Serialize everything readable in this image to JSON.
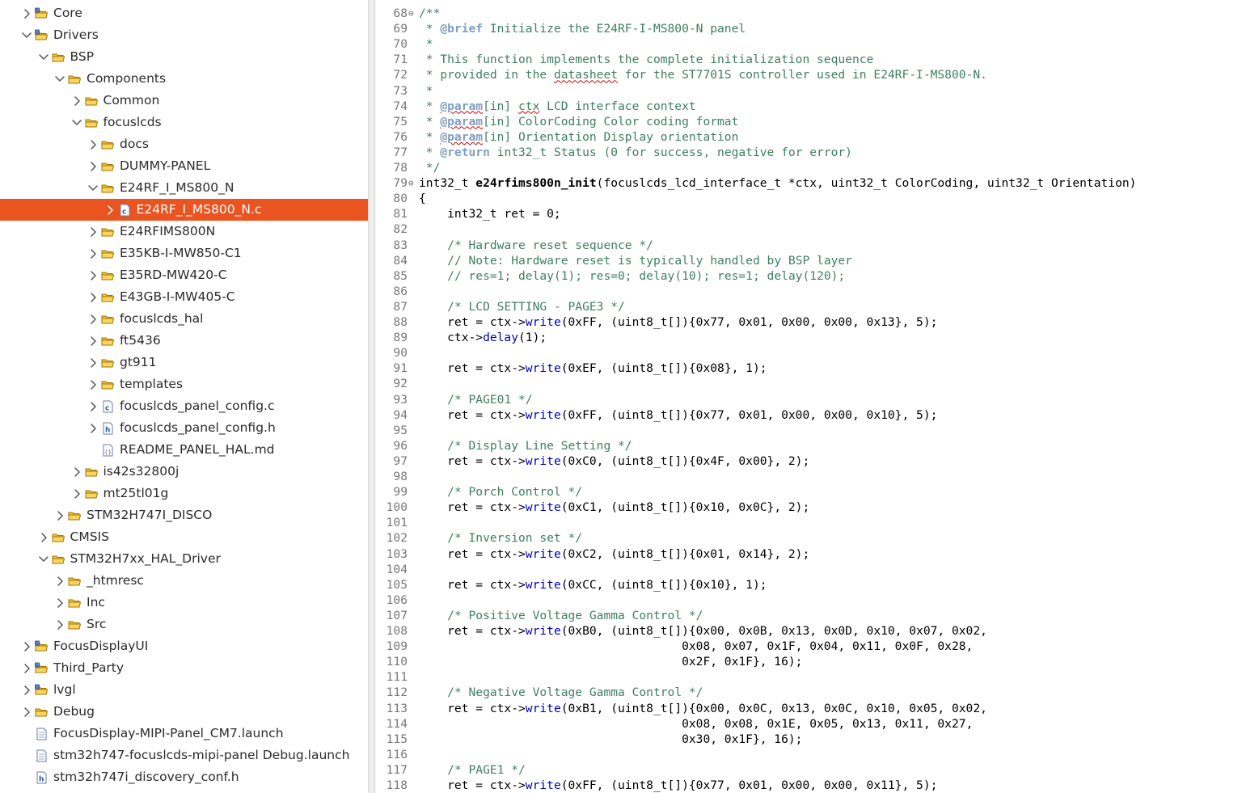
{
  "colors": {
    "selection_bg": "#e95420",
    "comment": "#3f7f5f",
    "method": "#0000c0",
    "line_number": "#787878",
    "folder": "#e0a000"
  },
  "tree": [
    {
      "label": "Core",
      "level": 1,
      "chevron": "right",
      "icon": "project-folder-icon"
    },
    {
      "label": "Drivers",
      "level": 1,
      "chevron": "down",
      "icon": "project-folder-icon"
    },
    {
      "label": "BSP",
      "level": 2,
      "chevron": "down",
      "icon": "folder-icon"
    },
    {
      "label": "Components",
      "level": 3,
      "chevron": "down",
      "icon": "folder-icon"
    },
    {
      "label": "Common",
      "level": 4,
      "chevron": "right",
      "icon": "folder-icon"
    },
    {
      "label": "focuslcds",
      "level": 4,
      "chevron": "down",
      "icon": "folder-icon"
    },
    {
      "label": "docs",
      "level": 5,
      "chevron": "right",
      "icon": "folder-icon"
    },
    {
      "label": "DUMMY-PANEL",
      "level": 5,
      "chevron": "right",
      "icon": "folder-icon"
    },
    {
      "label": "E24RF_I_MS800_N",
      "level": 5,
      "chevron": "down",
      "icon": "folder-icon"
    },
    {
      "label": "E24RF_I_MS800_N.c",
      "level": 6,
      "chevron": "right",
      "icon": "c-file-icon",
      "selected": true
    },
    {
      "label": "E24RFIMS800N",
      "level": 5,
      "chevron": "right",
      "icon": "folder-icon"
    },
    {
      "label": "E35KB-I-MW850-C1",
      "level": 5,
      "chevron": "right",
      "icon": "folder-icon"
    },
    {
      "label": "E35RD-MW420-C",
      "level": 5,
      "chevron": "right",
      "icon": "folder-icon"
    },
    {
      "label": "E43GB-I-MW405-C",
      "level": 5,
      "chevron": "right",
      "icon": "folder-icon"
    },
    {
      "label": "focuslcds_hal",
      "level": 5,
      "chevron": "right",
      "icon": "folder-icon"
    },
    {
      "label": "ft5436",
      "level": 5,
      "chevron": "right",
      "icon": "folder-icon"
    },
    {
      "label": "gt911",
      "level": 5,
      "chevron": "right",
      "icon": "folder-icon"
    },
    {
      "label": "templates",
      "level": 5,
      "chevron": "right",
      "icon": "folder-icon"
    },
    {
      "label": "focuslcds_panel_config.c",
      "level": 5,
      "chevron": "right",
      "icon": "c-file-icon"
    },
    {
      "label": "focuslcds_panel_config.h",
      "level": 5,
      "chevron": "right",
      "icon": "h-file-icon"
    },
    {
      "label": "README_PANEL_HAL.md",
      "level": 5,
      "chevron": "none",
      "icon": "md-file-icon"
    },
    {
      "label": "is42s32800j",
      "level": 4,
      "chevron": "right",
      "icon": "folder-icon"
    },
    {
      "label": "mt25tl01g",
      "level": 4,
      "chevron": "right",
      "icon": "folder-icon"
    },
    {
      "label": "STM32H747I_DISCO",
      "level": 3,
      "chevron": "right",
      "icon": "folder-icon"
    },
    {
      "label": "CMSIS",
      "level": 2,
      "chevron": "right",
      "icon": "folder-icon"
    },
    {
      "label": "STM32H7xx_HAL_Driver",
      "level": 2,
      "chevron": "down",
      "icon": "folder-icon"
    },
    {
      "label": "_htmresc",
      "level": 3,
      "chevron": "right",
      "icon": "folder-icon"
    },
    {
      "label": "Inc",
      "level": 3,
      "chevron": "right",
      "icon": "folder-icon"
    },
    {
      "label": "Src",
      "level": 3,
      "chevron": "right",
      "icon": "folder-icon"
    },
    {
      "label": "FocusDisplayUI",
      "level": 1,
      "chevron": "right",
      "icon": "project-folder-icon"
    },
    {
      "label": "Third_Party",
      "level": 1,
      "chevron": "right",
      "icon": "project-folder-icon"
    },
    {
      "label": "lvgl",
      "level": 1,
      "chevron": "right",
      "icon": "project-folder-icon"
    },
    {
      "label": "Debug",
      "level": 1,
      "chevron": "right",
      "icon": "folder-icon"
    },
    {
      "label": "FocusDisplay-MIPI-Panel_CM7.launch",
      "level": 1,
      "chevron": "none",
      "icon": "file-icon"
    },
    {
      "label": "stm32h747-focuslcds-mipi-panel Debug.launch",
      "level": 1,
      "chevron": "none",
      "icon": "file-icon"
    },
    {
      "label": "stm32h747i_discovery_conf.h",
      "level": 1,
      "chevron": "none",
      "icon": "h-file-icon"
    }
  ],
  "code": [
    {
      "n": "68",
      "fold": true,
      "segs": [
        {
          "t": "/**",
          "c": "comment"
        }
      ]
    },
    {
      "n": "69",
      "segs": [
        {
          "t": " * ",
          "c": "comment"
        },
        {
          "t": "@brief",
          "c": "doctag"
        },
        {
          "t": " Initialize the E24RF-I-MS800-N panel",
          "c": "comment"
        }
      ]
    },
    {
      "n": "70",
      "segs": [
        {
          "t": " *",
          "c": "comment"
        }
      ]
    },
    {
      "n": "71",
      "segs": [
        {
          "t": " * This function implements the complete initialization sequence",
          "c": "comment"
        }
      ]
    },
    {
      "n": "72",
      "segs": [
        {
          "t": " * provided in the ",
          "c": "comment"
        },
        {
          "t": "datasheet",
          "c": "comment",
          "sq": true
        },
        {
          "t": " for the ST7701S controller used in E24RF-I-MS800-N.",
          "c": "comment"
        }
      ]
    },
    {
      "n": "73",
      "segs": [
        {
          "t": " *",
          "c": "comment"
        }
      ]
    },
    {
      "n": "74",
      "segs": [
        {
          "t": " * ",
          "c": "comment"
        },
        {
          "t": "@param",
          "c": "doctag",
          "sq": true
        },
        {
          "t": "[in] ",
          "c": "comment"
        },
        {
          "t": "ctx",
          "c": "comment",
          "sq": true
        },
        {
          "t": " LCD interface context",
          "c": "comment"
        }
      ]
    },
    {
      "n": "75",
      "segs": [
        {
          "t": " * ",
          "c": "comment"
        },
        {
          "t": "@param",
          "c": "doctag",
          "sq": true
        },
        {
          "t": "[in] ColorCoding Color coding format",
          "c": "comment"
        }
      ]
    },
    {
      "n": "76",
      "segs": [
        {
          "t": " * ",
          "c": "comment"
        },
        {
          "t": "@param",
          "c": "doctag",
          "sq": true
        },
        {
          "t": "[in] Orientation Display orientation",
          "c": "comment"
        }
      ]
    },
    {
      "n": "77",
      "segs": [
        {
          "t": " * ",
          "c": "comment"
        },
        {
          "t": "@return",
          "c": "doctag"
        },
        {
          "t": " int32_t Status (0 for success, negative for error)",
          "c": "comment"
        }
      ]
    },
    {
      "n": "78",
      "segs": [
        {
          "t": " */",
          "c": "comment"
        }
      ]
    },
    {
      "n": "79",
      "fold": true,
      "segs": [
        {
          "t": "int32_t "
        },
        {
          "t": "e24rfims800n_init",
          "c": "fn"
        },
        {
          "t": "(focuslcds_lcd_interface_t *ctx, uint32_t ColorCoding, uint32_t Orientation)"
        }
      ]
    },
    {
      "n": "80",
      "segs": [
        {
          "t": "{"
        }
      ]
    },
    {
      "n": "81",
      "segs": [
        {
          "t": "    int32_t ret = 0;"
        }
      ]
    },
    {
      "n": "82",
      "segs": []
    },
    {
      "n": "83",
      "segs": [
        {
          "t": "    "
        },
        {
          "t": "/* Hardware reset sequence */",
          "c": "comment"
        }
      ]
    },
    {
      "n": "84",
      "segs": [
        {
          "t": "    "
        },
        {
          "t": "// Note: Hardware reset is typically handled by BSP layer",
          "c": "comment"
        }
      ]
    },
    {
      "n": "85",
      "segs": [
        {
          "t": "    "
        },
        {
          "t": "// res=1; delay(1); res=0; delay(10); res=1; delay(120);",
          "c": "comment"
        }
      ]
    },
    {
      "n": "86",
      "segs": []
    },
    {
      "n": "87",
      "segs": [
        {
          "t": "    "
        },
        {
          "t": "/* LCD SETTING - PAGE3 */",
          "c": "comment"
        }
      ]
    },
    {
      "n": "88",
      "segs": [
        {
          "t": "    ret = ctx->"
        },
        {
          "t": "write",
          "c": "method"
        },
        {
          "t": "(0xFF, (uint8_t[]){0x77, 0x01, 0x00, 0x00, 0x13}, 5);"
        }
      ]
    },
    {
      "n": "89",
      "segs": [
        {
          "t": "    ctx->"
        },
        {
          "t": "delay",
          "c": "method"
        },
        {
          "t": "(1);"
        }
      ]
    },
    {
      "n": "90",
      "segs": []
    },
    {
      "n": "91",
      "segs": [
        {
          "t": "    ret = ctx->"
        },
        {
          "t": "write",
          "c": "method"
        },
        {
          "t": "(0xEF, (uint8_t[]){0x08}, 1);"
        }
      ]
    },
    {
      "n": "92",
      "segs": []
    },
    {
      "n": "93",
      "segs": [
        {
          "t": "    "
        },
        {
          "t": "/* PAGE01 */",
          "c": "comment"
        }
      ]
    },
    {
      "n": "94",
      "segs": [
        {
          "t": "    ret = ctx->"
        },
        {
          "t": "write",
          "c": "method"
        },
        {
          "t": "(0xFF, (uint8_t[]){0x77, 0x01, 0x00, 0x00, 0x10}, 5);"
        }
      ]
    },
    {
      "n": "95",
      "segs": []
    },
    {
      "n": "96",
      "segs": [
        {
          "t": "    "
        },
        {
          "t": "/* Display Line Setting */",
          "c": "comment"
        }
      ]
    },
    {
      "n": "97",
      "segs": [
        {
          "t": "    ret = ctx->"
        },
        {
          "t": "write",
          "c": "method"
        },
        {
          "t": "(0xC0, (uint8_t[]){0x4F, 0x00}, 2);"
        }
      ]
    },
    {
      "n": "98",
      "segs": []
    },
    {
      "n": "99",
      "segs": [
        {
          "t": "    "
        },
        {
          "t": "/* Porch Control */",
          "c": "comment"
        }
      ]
    },
    {
      "n": "100",
      "segs": [
        {
          "t": "    ret = ctx->"
        },
        {
          "t": "write",
          "c": "method"
        },
        {
          "t": "(0xC1, (uint8_t[]){0x10, 0x0C}, 2);"
        }
      ]
    },
    {
      "n": "101",
      "segs": []
    },
    {
      "n": "102",
      "segs": [
        {
          "t": "    "
        },
        {
          "t": "/* Inversion set */",
          "c": "comment"
        }
      ]
    },
    {
      "n": "103",
      "segs": [
        {
          "t": "    ret = ctx->"
        },
        {
          "t": "write",
          "c": "method"
        },
        {
          "t": "(0xC2, (uint8_t[]){0x01, 0x14}, 2);"
        }
      ]
    },
    {
      "n": "104",
      "segs": []
    },
    {
      "n": "105",
      "segs": [
        {
          "t": "    ret = ctx->"
        },
        {
          "t": "write",
          "c": "method"
        },
        {
          "t": "(0xCC, (uint8_t[]){0x10}, 1);"
        }
      ]
    },
    {
      "n": "106",
      "segs": []
    },
    {
      "n": "107",
      "segs": [
        {
          "t": "    "
        },
        {
          "t": "/* Positive Voltage Gamma Control */",
          "c": "comment"
        }
      ]
    },
    {
      "n": "108",
      "segs": [
        {
          "t": "    ret = ctx->"
        },
        {
          "t": "write",
          "c": "method"
        },
        {
          "t": "(0xB0, (uint8_t[]){0x00, 0x0B, 0x13, 0x0D, 0x10, 0x07, 0x02,"
        }
      ]
    },
    {
      "n": "109",
      "segs": [
        {
          "t": "                                     0x08, 0x07, 0x1F, 0x04, 0x11, 0x0F, 0x28,"
        }
      ]
    },
    {
      "n": "110",
      "segs": [
        {
          "t": "                                     0x2F, 0x1F}, 16);"
        }
      ]
    },
    {
      "n": "111",
      "segs": []
    },
    {
      "n": "112",
      "segs": [
        {
          "t": "    "
        },
        {
          "t": "/* Negative Voltage Gamma Control */",
          "c": "comment"
        }
      ]
    },
    {
      "n": "113",
      "segs": [
        {
          "t": "    ret = ctx->"
        },
        {
          "t": "write",
          "c": "method"
        },
        {
          "t": "(0xB1, (uint8_t[]){0x00, 0x0C, 0x13, 0x0C, 0x10, 0x05, 0x02,"
        }
      ]
    },
    {
      "n": "114",
      "segs": [
        {
          "t": "                                     0x08, 0x08, 0x1E, 0x05, 0x13, 0x11, 0x27,"
        }
      ]
    },
    {
      "n": "115",
      "segs": [
        {
          "t": "                                     0x30, 0x1F}, 16);"
        }
      ]
    },
    {
      "n": "116",
      "segs": []
    },
    {
      "n": "117",
      "segs": [
        {
          "t": "    "
        },
        {
          "t": "/* PAGE1 */",
          "c": "comment"
        }
      ]
    },
    {
      "n": "118",
      "segs": [
        {
          "t": "    ret = ctx->"
        },
        {
          "t": "write",
          "c": "method"
        },
        {
          "t": "(0xFF, (uint8_t[]){0x77, 0x01, 0x00, 0x00, 0x11}, 5);"
        }
      ]
    }
  ]
}
